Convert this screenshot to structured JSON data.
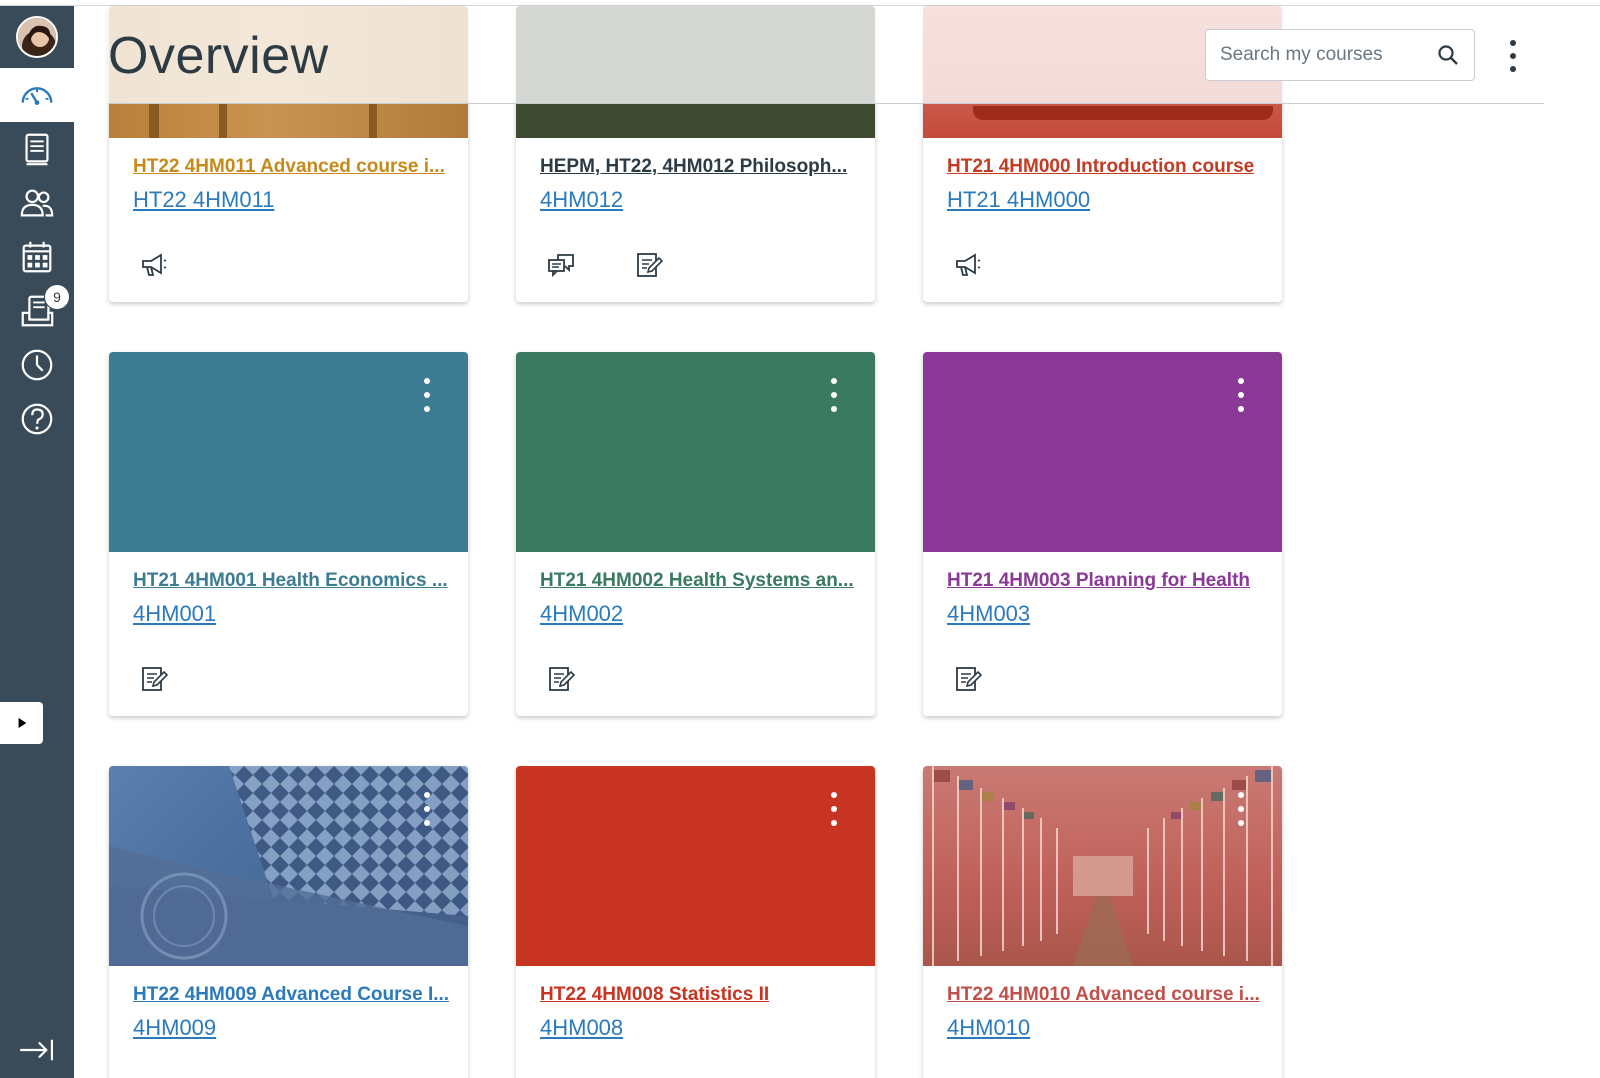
{
  "header": {
    "title": "Overview",
    "search_placeholder": "Search my courses"
  },
  "sidebar": {
    "inbox_badge": "9"
  },
  "cards": [
    {
      "title": "HT22 4HM011 Advanced course i...",
      "code": "HT22 4HM011",
      "color": "#c68a1a"
    },
    {
      "title": "HEPM, HT22, 4HM012 Philosoph...",
      "code": "4HM012",
      "color": "#2d3b45"
    },
    {
      "title": "HT21 4HM000 Introduction course",
      "code": "HT21 4HM000",
      "color": "#c23b22"
    },
    {
      "title": "HT21 4HM001 Health Economics ...",
      "code": "4HM001",
      "color": "#3d7d93"
    },
    {
      "title": "HT21 4HM002 Health Systems an...",
      "code": "4HM002",
      "color": "#3a7a60"
    },
    {
      "title": "HT21 4HM003 Planning for Health",
      "code": "4HM003",
      "color": "#8a3a96"
    },
    {
      "title": "HT22 4HM009 Advanced Course I...",
      "code": "4HM009",
      "color": "#3c6aa0"
    },
    {
      "title": "HT22 4HM008 Statistics II",
      "code": "4HM008",
      "color": "#c73522"
    },
    {
      "title": "HT22 4HM010 Advanced course i...",
      "code": "4HM010",
      "color": "#c0504a"
    }
  ],
  "colors": {
    "sidebar_bg": "#394b58",
    "link_blue": "#2b7abc",
    "hero_teal": "#3d7d93",
    "hero_green": "#3a7a60",
    "hero_purple": "#8a3a96",
    "hero_red": "#c73522"
  }
}
